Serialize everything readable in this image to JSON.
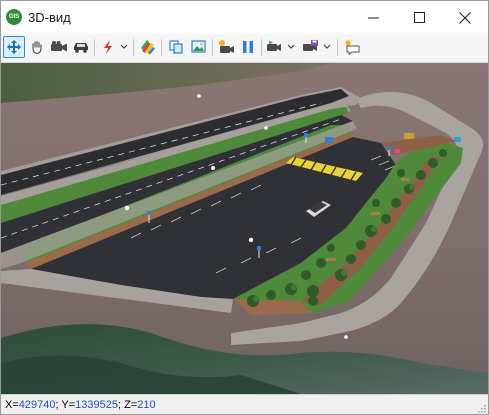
{
  "window": {
    "title": "3D-вид",
    "app_icon_text": "GIS",
    "controls": {
      "minimize": "minimize",
      "maximize": "maximize",
      "close": "close"
    }
  },
  "toolbar": {
    "tools": [
      {
        "name": "pan-tool",
        "icon": "move-arrows-icon",
        "active": true
      },
      {
        "name": "hand-tool",
        "icon": "hand-icon"
      },
      {
        "name": "camera-tool",
        "icon": "video-camera-icon"
      },
      {
        "name": "car-tool",
        "icon": "car-icon"
      },
      {
        "name": "lightning-tool",
        "icon": "lightning-icon",
        "dropdown": true
      },
      {
        "name": "layers-tool",
        "icon": "color-layers-icon"
      },
      {
        "name": "copy-tool",
        "icon": "copy-icon"
      },
      {
        "name": "image-tool",
        "icon": "picture-icon"
      },
      {
        "name": "record-tool",
        "icon": "record-camera-icon"
      },
      {
        "name": "pause-tool",
        "icon": "pause-icon"
      },
      {
        "name": "play-tool",
        "icon": "play-camera-icon",
        "dropdown": true
      },
      {
        "name": "save-view-tool",
        "icon": "save-icon",
        "dropdown": true
      },
      {
        "name": "comment-tool",
        "icon": "comment-icon"
      }
    ]
  },
  "status": {
    "x_label": "X=",
    "x_value": "429740",
    "y_label": "; Y=",
    "y_value": "1339525",
    "z_label": "; Z=",
    "z_value": "210"
  },
  "colors": {
    "accent": "#2f8fce",
    "grass": "#4f8a3a",
    "asphalt": "#2f3136",
    "sidewalk": "#a9a3a0",
    "terrain": "#7a6a67",
    "status_number": "#1f4fbf"
  }
}
